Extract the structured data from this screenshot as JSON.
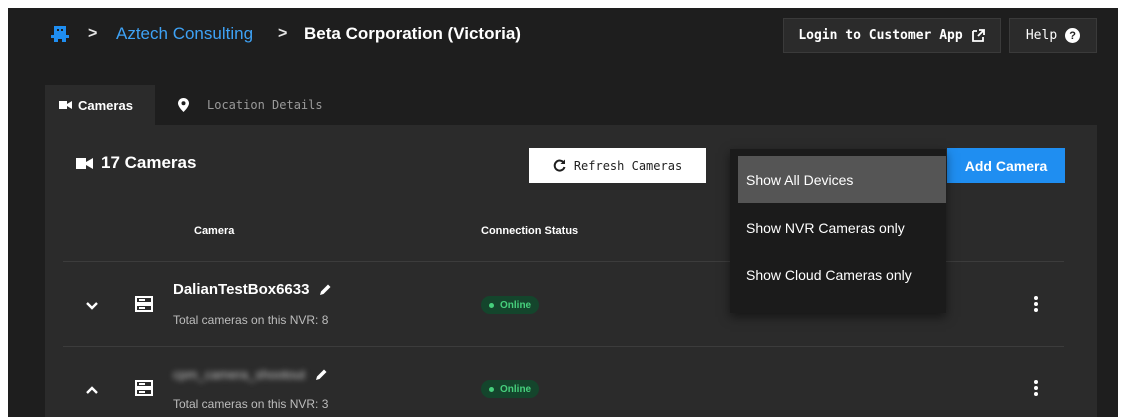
{
  "header": {
    "breadcrumb_org": "Aztech Consulting",
    "breadcrumb_current": "Beta Corporation (Victoria)",
    "separator": ">",
    "login_label": "Login to Customer App",
    "help_label": "Help"
  },
  "tabs": [
    {
      "label": "Cameras",
      "icon": "video-camera-icon",
      "active": true
    },
    {
      "label": "Location Details",
      "icon": "map-pin-icon",
      "active": false
    }
  ],
  "panel": {
    "camera_count_label": "17 Cameras",
    "refresh_label": "Refresh Cameras",
    "add_label": "Add Camera"
  },
  "table": {
    "columns": [
      "Camera",
      "Connection Status"
    ],
    "rows": [
      {
        "name": "DalianTestBox6633",
        "subtitle": "Total cameras on this NVR: 8",
        "status": "Online",
        "expanded": false
      },
      {
        "name": "cpm_camera_shootout",
        "subtitle": "Total cameras on this NVR: 3",
        "status": "Online",
        "expanded": true,
        "blurred": true
      }
    ]
  },
  "dropdown": {
    "items": [
      {
        "label": "Show All Devices",
        "active": true
      },
      {
        "label": "Show NVR Cameras only",
        "active": false
      },
      {
        "label": "Show Cloud Cameras only",
        "active": false
      }
    ]
  },
  "colors": {
    "background": "#1e1e1e",
    "panel": "#2b2b2b",
    "accent": "#1f8ef1",
    "link": "#3ea2f5",
    "online": "#46cf7c"
  }
}
